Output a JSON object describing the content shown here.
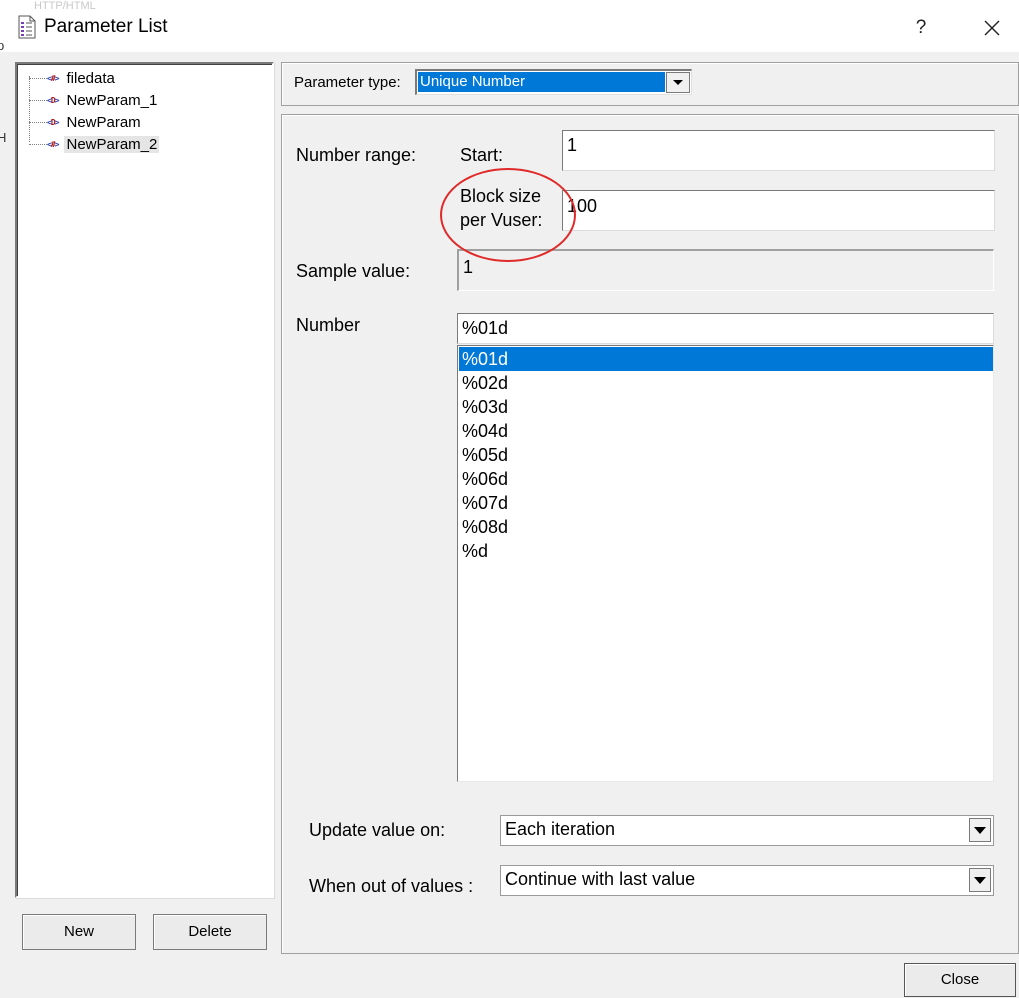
{
  "window": {
    "title": "Parameter List",
    "help_label": "?",
    "background_artifact": "HTTP/HTML",
    "left_artifacts": [
      "p",
      "H"
    ]
  },
  "tree": {
    "items": [
      {
        "icon": "<#>",
        "label": "filedata"
      },
      {
        "icon": "<D>",
        "label": "NewParam_1"
      },
      {
        "icon": "<D>",
        "label": "NewParam"
      },
      {
        "icon": "<#>",
        "label": "NewParam_2"
      }
    ]
  },
  "buttons": {
    "new": "New",
    "delete": "Delete",
    "close": "Close"
  },
  "parameter_type": {
    "label": "Parameter type:",
    "value": "Unique Number"
  },
  "settings": {
    "number_range_label": "Number range:",
    "start_label": "Start:",
    "start_value": "1",
    "block_size_label_line1": "Block size",
    "block_size_label_line2": "per Vuser:",
    "block_size_value": "100",
    "sample_label": "Sample value:",
    "sample_value": "1",
    "number_label": "Number",
    "number_value": "%01d",
    "format_options": [
      "%01d",
      "%02d",
      "%03d",
      "%04d",
      "%05d",
      "%06d",
      "%07d",
      "%08d",
      "%d"
    ],
    "format_selected": "%01d",
    "update_label": "Update value on:",
    "update_value": "Each iteration",
    "out_of_values_label": "When out of values :",
    "out_of_values_value": "Continue with last value"
  },
  "colors": {
    "selection": "#0078d7",
    "annotation_circle": "#e02a2a"
  }
}
